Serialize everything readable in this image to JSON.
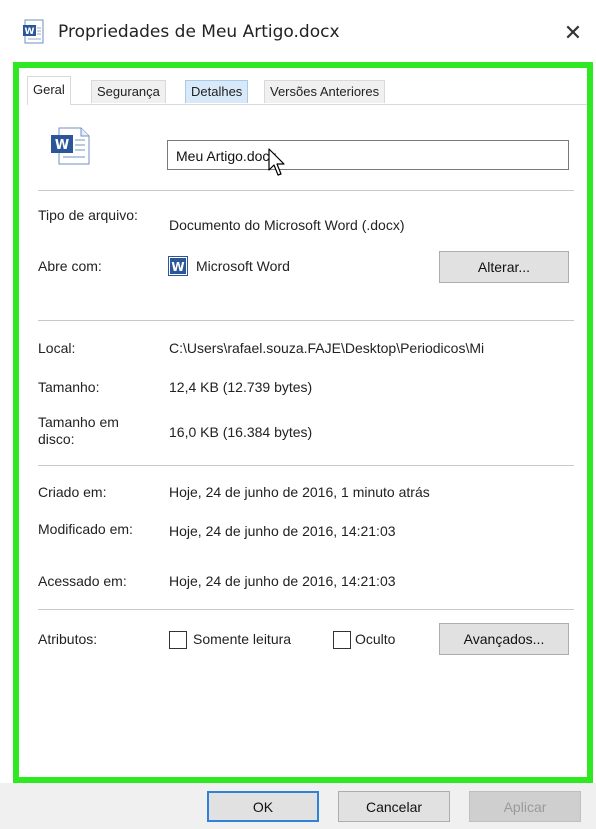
{
  "window": {
    "title": "Propriedades de Meu Artigo.docx",
    "close_glyph": "✕"
  },
  "tabs": [
    {
      "label": "Geral",
      "active": true
    },
    {
      "label": "Segurança",
      "active": false
    },
    {
      "label": "Detalhes",
      "active": false,
      "hover": true
    },
    {
      "label": "Versões Anteriores",
      "active": false
    }
  ],
  "general": {
    "file_icon": "word-document-icon",
    "file_name": "Meu Artigo.docx",
    "type_label": "Tipo de arquivo:",
    "type_value": "Documento do Microsoft Word (.docx)",
    "opens_with_label": "Abre com:",
    "opens_with_icon": "word-app-icon",
    "opens_with_value": "Microsoft Word",
    "change_button": "Alterar...",
    "location_label": "Local:",
    "location_value": "C:\\Users\\rafael.souza.FAJE\\Desktop\\Periodicos\\Mi",
    "size_label": "Tamanho:",
    "size_value": "12,4 KB (12.739 bytes)",
    "size_on_disk_label": "Tamanho em disco:",
    "size_on_disk_value": "16,0 KB (16.384 bytes)",
    "created_label": "Criado em:",
    "created_value": "Hoje, 24 de junho de 2016, 1 minuto atrás",
    "modified_label": "Modificado em:",
    "modified_value": "Hoje, 24 de junho de 2016, 14:21:03",
    "accessed_label": "Acessado em:",
    "accessed_value": "Hoje, 24 de junho de 2016, 14:21:03",
    "attributes_label": "Atributos:",
    "readonly_label": "Somente leitura",
    "hidden_label": "Oculto",
    "advanced_button": "Avançados..."
  },
  "footer": {
    "ok": "OK",
    "cancel": "Cancelar",
    "apply": "Aplicar"
  },
  "colors": {
    "highlight_frame": "#2ee822",
    "word_blue": "#2b579a"
  }
}
